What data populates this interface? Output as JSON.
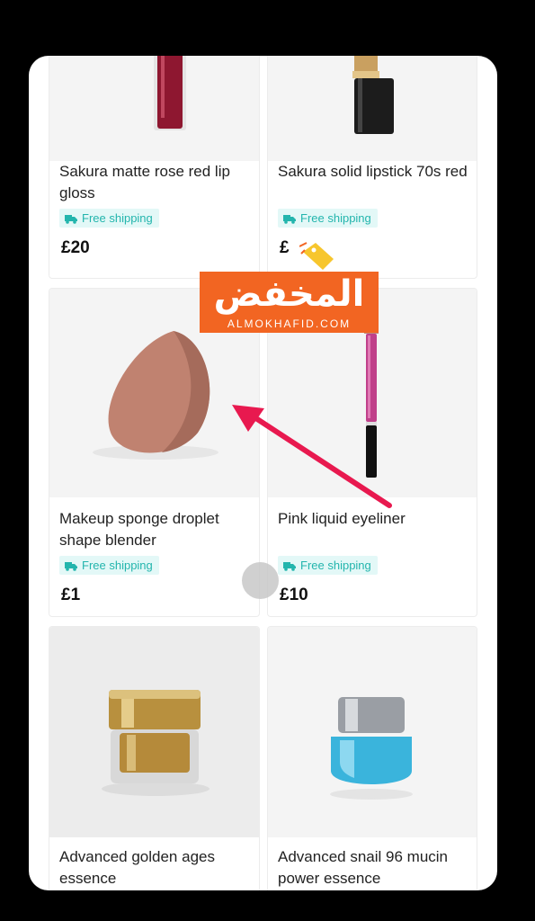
{
  "products": [
    {
      "title": "Sakura matte rose red lip gloss",
      "shipping": "Free shipping",
      "price": "£20"
    },
    {
      "title": "Sakura solid lipstick 70s red",
      "shipping": "Free shipping",
      "price": "£"
    },
    {
      "title": "Makeup sponge droplet shape blender",
      "shipping": "Free shipping",
      "price": "£1"
    },
    {
      "title": "Pink liquid eyeliner",
      "shipping": "Free shipping",
      "price": "£10"
    },
    {
      "title": "Advanced golden ages essence"
    },
    {
      "title": "Advanced snail 96 mucin power essence"
    }
  ],
  "watermark": {
    "arabic": "المخفض",
    "latin": "ALMOKHAFID.COM"
  },
  "colors": {
    "shipping_badge_bg": "#e3f8f7",
    "shipping_text": "#23b5ad",
    "watermark": "#f26522",
    "arrow": "#e8194f"
  }
}
